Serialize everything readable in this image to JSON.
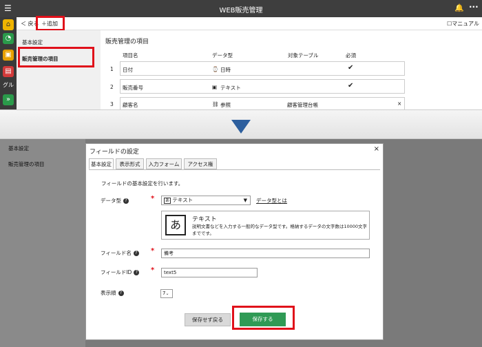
{
  "app": {
    "title": "WEB販売管理"
  },
  "toolbar": {
    "back": "＜ 戻る",
    "add": "＋追加",
    "manual": "☐マニュアル"
  },
  "rail": {
    "group_label": "グル"
  },
  "left_menu": {
    "items": [
      "基本設定",
      "販売管理の項目"
    ]
  },
  "section": {
    "title": "販売管理の項目"
  },
  "table": {
    "headers": [
      "項目名",
      "データ型",
      "対象テーブル",
      "必須"
    ],
    "rows": [
      {
        "num": "1",
        "name": "日付",
        "type_icon": "⌚",
        "type": "日時",
        "target": "",
        "required": "✔"
      },
      {
        "num": "2",
        "name": "販売番号",
        "type_icon": "▣",
        "type": "テキスト",
        "target": "",
        "required": "✔"
      },
      {
        "num": "3",
        "name": "顧客名",
        "type_icon": "⛓",
        "type": "参照",
        "target": "顧客管理台帳",
        "required": "×"
      }
    ]
  },
  "bottom_left": {
    "items": [
      "基本設定",
      "販売管理の項目"
    ]
  },
  "dialog": {
    "title": "フィールドの設定",
    "close": "×",
    "tabs": [
      "基本設定",
      "表示形式",
      "入力フォーム",
      "アクセス権"
    ],
    "description": "フィールドの基本設定を行います。",
    "data_type_label": "データ型",
    "data_type_value": "テキスト",
    "data_type_icon": "あ",
    "data_type_link": "データ型とは",
    "type_card": {
      "icon": "あ",
      "name": "テキスト",
      "description": "説明文書などを入力する一般的なデータ型です。格納するデータの文字数は10000文字までです。"
    },
    "field_name_label": "フィールド名",
    "field_name_value": "備考",
    "field_id_label": "フィールドID",
    "field_id_value": "text5",
    "display_order_label": "表示順",
    "display_order_value": "7",
    "required_mark": "*",
    "help_mark": "?",
    "cancel_button": "保存せず戻る",
    "save_button": "保存する"
  },
  "colors": {
    "topbar": "#3e3e3e",
    "highlight": "#e0101a",
    "save": "#2f9a55",
    "arrow": "#2d5f9e"
  }
}
